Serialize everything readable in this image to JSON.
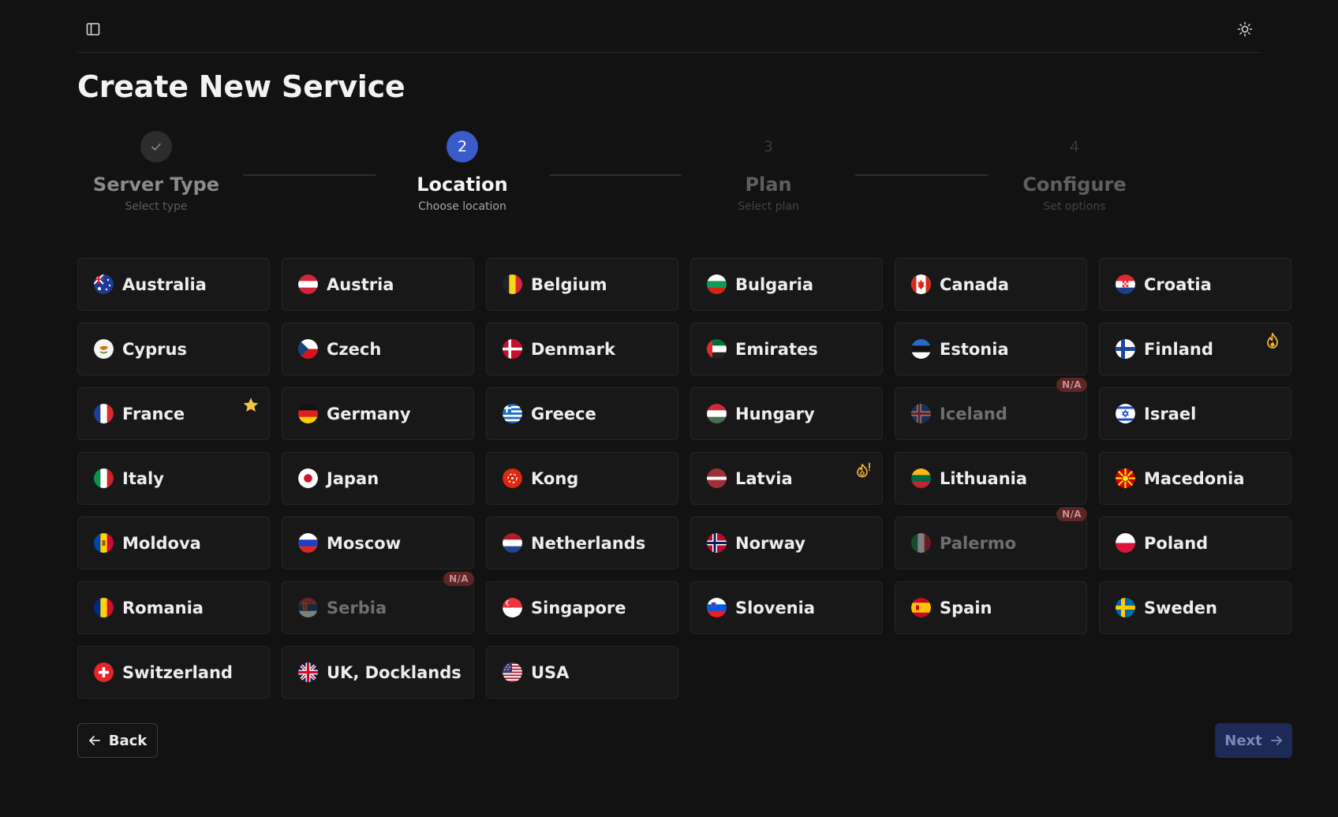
{
  "page_title": "Create New Service",
  "steps": [
    {
      "number": "",
      "title": "Server Type",
      "subtitle": "Select type",
      "state": "done"
    },
    {
      "number": "2",
      "title": "Location",
      "subtitle": "Choose location",
      "state": "active"
    },
    {
      "number": "3",
      "title": "Plan",
      "subtitle": "Select plan",
      "state": "todo"
    },
    {
      "number": "4",
      "title": "Configure",
      "subtitle": "Set options",
      "state": "todo"
    }
  ],
  "locations": [
    {
      "name": "Australia",
      "flag": "australia-flag-icon"
    },
    {
      "name": "Austria",
      "flag": "austria-flag-icon"
    },
    {
      "name": "Belgium",
      "flag": "belgium-flag-icon"
    },
    {
      "name": "Bulgaria",
      "flag": "bulgaria-flag-icon"
    },
    {
      "name": "Canada",
      "flag": "canada-flag-icon"
    },
    {
      "name": "Croatia",
      "flag": "croatia-flag-icon"
    },
    {
      "name": "Cyprus",
      "flag": "cyprus-flag-icon"
    },
    {
      "name": "Czech",
      "flag": "czech-flag-icon"
    },
    {
      "name": "Denmark",
      "flag": "denmark-flag-icon"
    },
    {
      "name": "Emirates",
      "flag": "emirates-flag-icon"
    },
    {
      "name": "Estonia",
      "flag": "estonia-flag-icon"
    },
    {
      "name": "Finland",
      "flag": "finland-flag-icon",
      "badge_icon": "fire-icon"
    },
    {
      "name": "France",
      "flag": "france-flag-icon",
      "badge_icon": "star-icon"
    },
    {
      "name": "Germany",
      "flag": "germany-flag-icon"
    },
    {
      "name": "Greece",
      "flag": "greece-flag-icon"
    },
    {
      "name": "Hungary",
      "flag": "hungary-flag-icon"
    },
    {
      "name": "Iceland",
      "flag": "iceland-flag-icon",
      "na_label": "N/A",
      "disabled": true
    },
    {
      "name": "Israel",
      "flag": "israel-flag-icon"
    },
    {
      "name": "Italy",
      "flag": "italy-flag-icon"
    },
    {
      "name": "Japan",
      "flag": "japan-flag-icon"
    },
    {
      "name": "Kong",
      "flag": "hong-kong-flag-icon"
    },
    {
      "name": "Latvia",
      "flag": "latvia-flag-icon",
      "badge_icon": "hot-alert-icon"
    },
    {
      "name": "Lithuania",
      "flag": "lithuania-flag-icon"
    },
    {
      "name": "Macedonia",
      "flag": "macedonia-flag-icon"
    },
    {
      "name": "Moldova",
      "flag": "moldova-flag-icon"
    },
    {
      "name": "Moscow",
      "flag": "russia-flag-icon"
    },
    {
      "name": "Netherlands",
      "flag": "netherlands-flag-icon"
    },
    {
      "name": "Norway",
      "flag": "norway-flag-icon"
    },
    {
      "name": "Palermo",
      "flag": "italy-flag-icon",
      "na_label": "N/A",
      "disabled": true
    },
    {
      "name": "Poland",
      "flag": "poland-flag-icon"
    },
    {
      "name": "Romania",
      "flag": "romania-flag-icon"
    },
    {
      "name": "Serbia",
      "flag": "serbia-flag-icon",
      "na_label": "N/A",
      "disabled": true
    },
    {
      "name": "Singapore",
      "flag": "singapore-flag-icon"
    },
    {
      "name": "Slovenia",
      "flag": "slovenia-flag-icon"
    },
    {
      "name": "Spain",
      "flag": "spain-flag-icon"
    },
    {
      "name": "Sweden",
      "flag": "sweden-flag-icon"
    },
    {
      "name": "Switzerland",
      "flag": "switzerland-flag-icon"
    },
    {
      "name": "UK, Docklands",
      "flag": "uk-flag-icon"
    },
    {
      "name": "USA",
      "flag": "usa-flag-icon"
    }
  ],
  "buttons": {
    "back_label": "Back",
    "next_label": "Next"
  },
  "colors": {
    "background": "#121212",
    "card": "#181818",
    "accent": "#3a5cc9",
    "na_badge": "#5a2626",
    "star": "#f5c542",
    "fire": "#f2b233"
  }
}
